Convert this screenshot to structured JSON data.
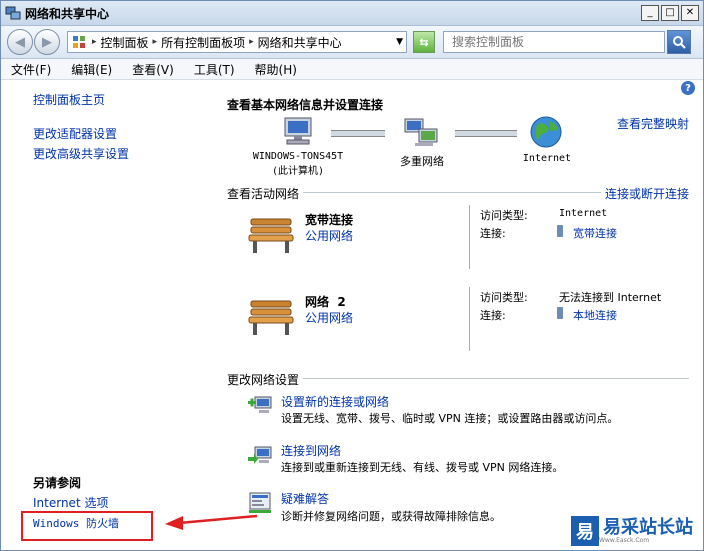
{
  "window": {
    "title": "网络和共享中心"
  },
  "address": {
    "crumbs": [
      "控制面板",
      "所有控制面板项",
      "网络和共享中心"
    ],
    "search_placeholder": "搜索控制面板"
  },
  "menu": [
    "文件(F)",
    "编辑(E)",
    "查看(V)",
    "工具(T)",
    "帮助(H)"
  ],
  "sidebar": {
    "home": "控制面板主页",
    "links": [
      "更改适配器设置",
      "更改高级共享设置"
    ],
    "see_also_title": "另请参阅",
    "see_also": [
      "Internet 选项",
      "Windows 防火墙"
    ]
  },
  "main": {
    "heading": "查看基本网络信息并设置连接",
    "full_map": "查看完整映射",
    "nodes": [
      {
        "line1": "WINDOWS-TONS45T",
        "line2": "(此计算机)"
      },
      {
        "line1": "多重网络",
        "line2": ""
      },
      {
        "line1": "Internet",
        "line2": ""
      }
    ],
    "active_title": "查看活动网络",
    "connect_link": "连接或断开连接",
    "access_type_label": "访问类型:",
    "connection_label": "连接:",
    "networks": [
      {
        "name": "宽带连接",
        "type": "公用网络",
        "access": "Internet",
        "connection": "宽带连接"
      },
      {
        "name": "网络  2",
        "type": "公用网络",
        "access": "无法连接到 Internet",
        "connection": "本地连接"
      }
    ],
    "change_title": "更改网络设置",
    "tasks": [
      {
        "title": "设置新的连接或网络",
        "desc": "设置无线、宽带、拨号、临时或 VPN 连接；或设置路由器或访问点。"
      },
      {
        "title": "连接到网络",
        "desc": "连接到或重新连接到无线、有线、拨号或 VPN 网络连接。"
      },
      {
        "title": "疑难解答",
        "desc": "诊断并修复网络问题，或获得故障排除信息。"
      }
    ]
  },
  "watermark": {
    "glyph": "易",
    "text": "易采站长站",
    "sub": "Www.Easck.Com"
  }
}
